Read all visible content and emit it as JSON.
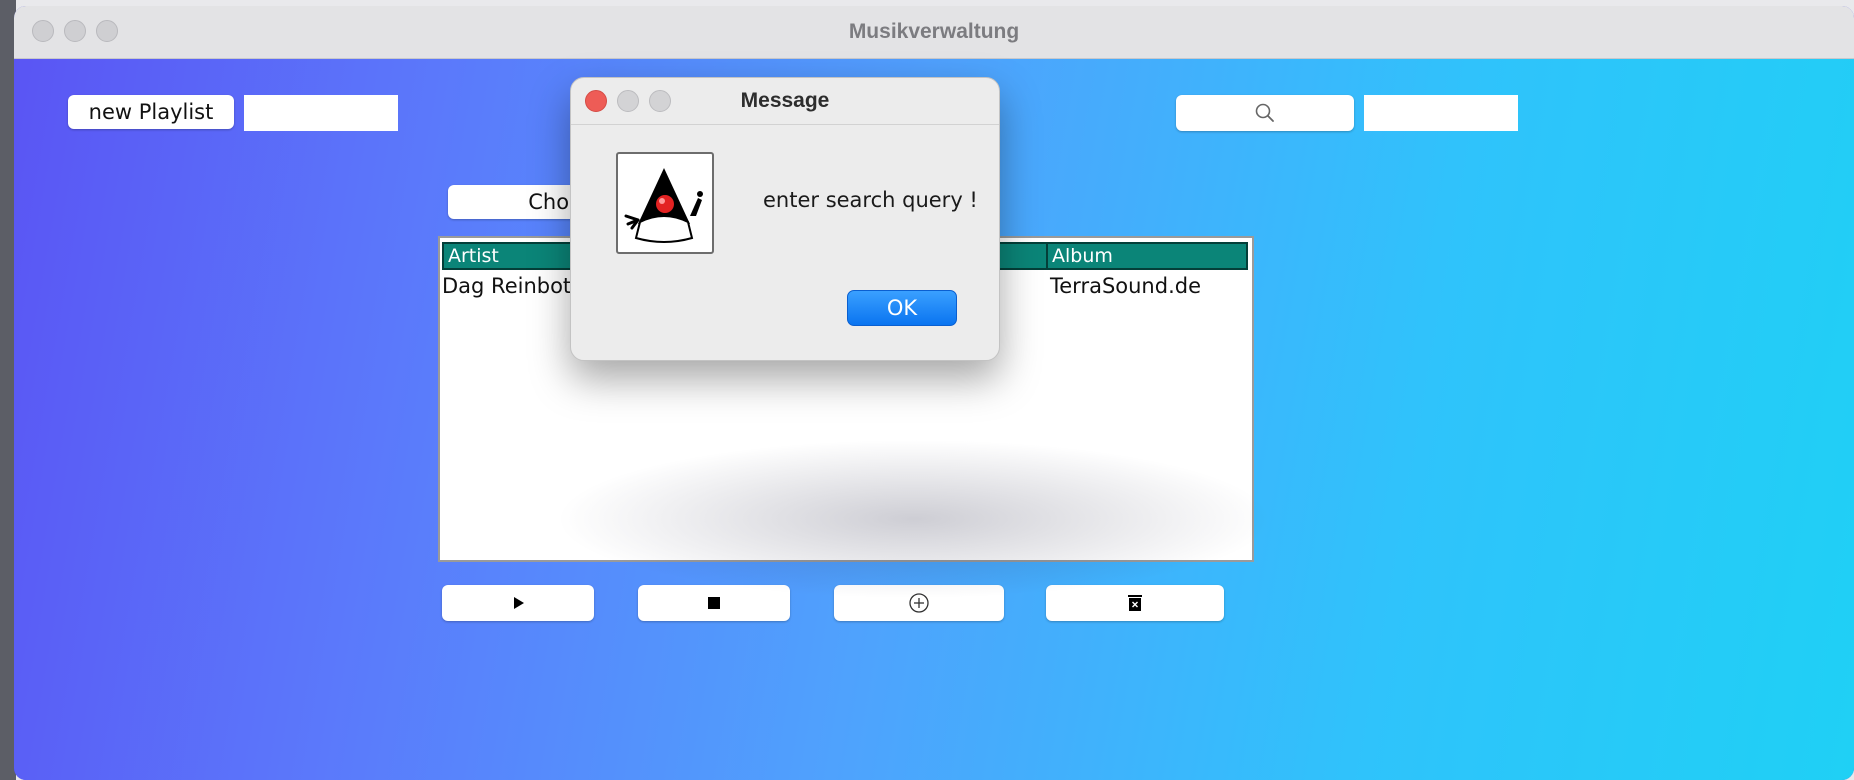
{
  "window": {
    "title": "Musikverwaltung"
  },
  "toolbar": {
    "new_playlist_label": "new Playlist",
    "playlist_name_value": "",
    "search_value": "",
    "choose_label": "Choose"
  },
  "table": {
    "columns": [
      "Artist",
      "Album"
    ],
    "rows": [
      {
        "artist": "Dag Reinbott",
        "album": "TerraSound.de"
      }
    ]
  },
  "controls": {
    "icons": [
      "play-icon",
      "stop-icon",
      "add-circle-icon",
      "trash-icon"
    ]
  },
  "dialog": {
    "title": "Message",
    "message": "enter search query !",
    "ok_label": "OK",
    "icon": "duke-java-icon"
  },
  "colors": {
    "table_header": "#0b8578",
    "ok_button": "#0a74f0",
    "close_red": "#ee5c56"
  }
}
